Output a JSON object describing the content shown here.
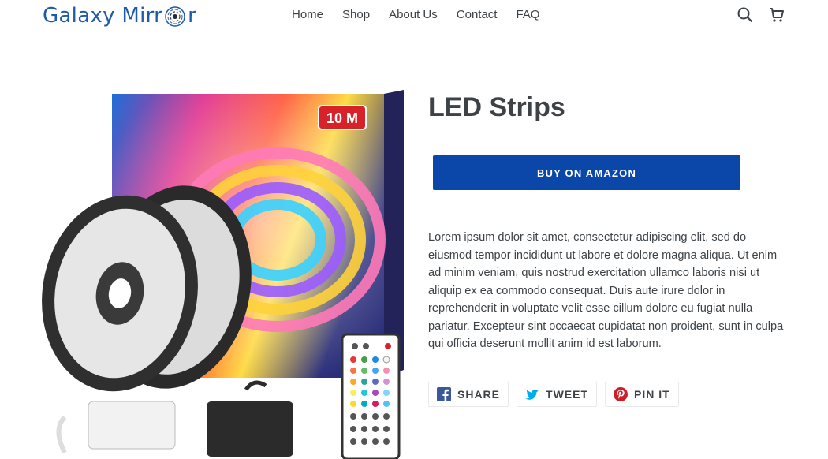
{
  "header": {
    "logo": {
      "part1": "Galaxy Mirr",
      "part2": "r"
    },
    "nav": [
      "Home",
      "Shop",
      "About Us",
      "Contact",
      "FAQ"
    ],
    "search_icon": "search-icon",
    "cart_icon": "cart-icon"
  },
  "product": {
    "title": "LED Strips",
    "image_badge": "10 M",
    "buy_label": "BUY ON AMAZON",
    "description": "Lorem ipsum dolor sit amet, consectetur adipiscing elit, sed do eiusmod tempor incididunt ut labore et dolore magna aliqua. Ut enim ad minim veniam, quis nostrud exercitation ullamco laboris nisi ut aliquip ex ea commodo consequat. Duis aute irure dolor in reprehenderit in voluptate velit esse cillum dolore eu fugiat nulla pariatur. Excepteur sint occaecat cupidatat non proident, sunt in culpa qui officia deserunt mollit anim id est laborum."
  },
  "share": [
    {
      "label": "SHARE",
      "icon": "facebook-icon"
    },
    {
      "label": "TWEET",
      "icon": "twitter-icon"
    },
    {
      "label": "PIN IT",
      "icon": "pinterest-icon"
    }
  ],
  "colors": {
    "accent": "#0b47a8",
    "logo": "#1f5aa8",
    "text": "#3d4246",
    "border": "#e8e9eb"
  }
}
